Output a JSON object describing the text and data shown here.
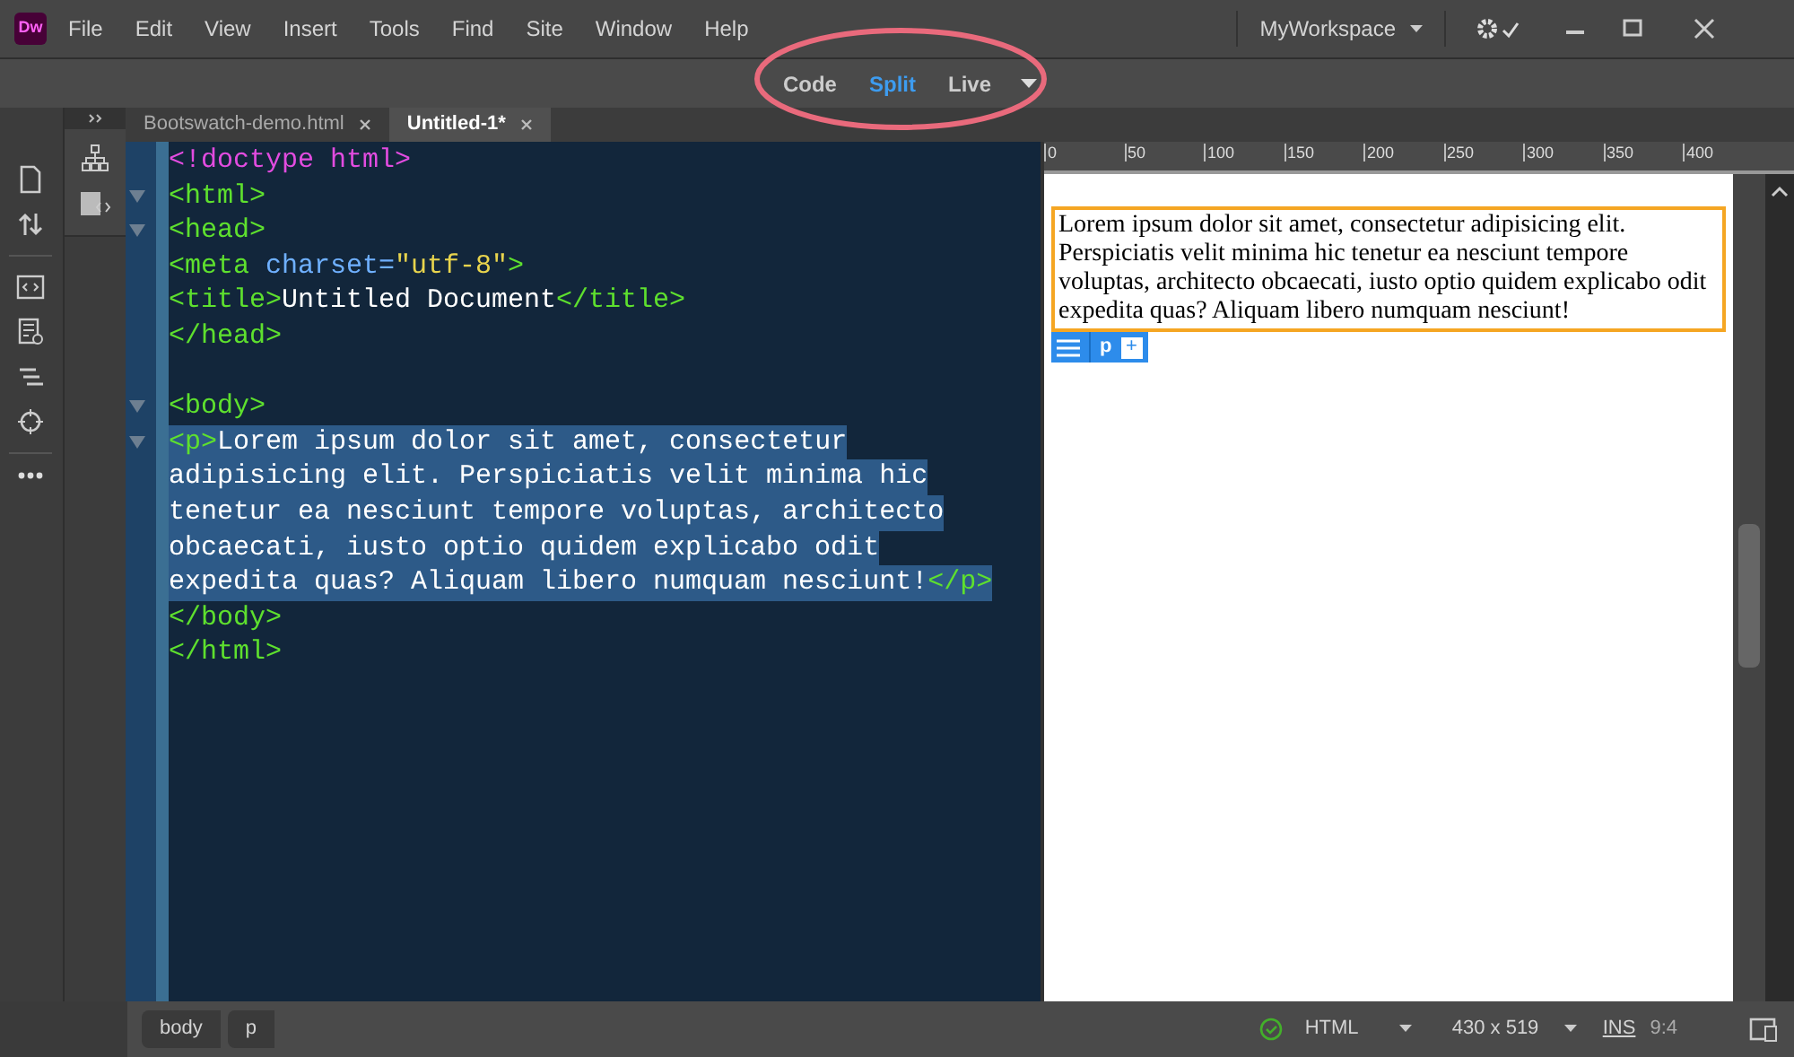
{
  "app": {
    "logo": "Dw"
  },
  "menu": [
    "File",
    "Edit",
    "View",
    "Insert",
    "Tools",
    "Find",
    "Site",
    "Window",
    "Help"
  ],
  "workspace": {
    "label": "MyWorkspace"
  },
  "view_modes": [
    {
      "label": "Code",
      "selected": false
    },
    {
      "label": "Split",
      "selected": true
    },
    {
      "label": "Live",
      "selected": false
    }
  ],
  "tabs": [
    {
      "label": "Bootswatch-demo.html",
      "selected": false
    },
    {
      "label": "Untitled-1*",
      "selected": true
    }
  ],
  "code_lines": [
    {
      "fold": false,
      "selected": false,
      "tokens": [
        {
          "kind": "doctype",
          "text": "<!doctype html>"
        }
      ]
    },
    {
      "fold": true,
      "selected": false,
      "tokens": [
        {
          "kind": "tag",
          "text": "<html>"
        }
      ]
    },
    {
      "fold": true,
      "selected": false,
      "tokens": [
        {
          "kind": "tag",
          "text": "<head>"
        }
      ]
    },
    {
      "fold": false,
      "selected": false,
      "tokens": [
        {
          "kind": "tag",
          "text": "<meta "
        },
        {
          "kind": "attr",
          "text": "charset="
        },
        {
          "kind": "string",
          "text": "\"utf-8\""
        },
        {
          "kind": "tag",
          "text": ">"
        }
      ]
    },
    {
      "fold": false,
      "selected": false,
      "tokens": [
        {
          "kind": "tag",
          "text": "<title>"
        },
        {
          "kind": "text",
          "text": "Untitled Document"
        },
        {
          "kind": "tag",
          "text": "</title>"
        }
      ]
    },
    {
      "fold": false,
      "selected": false,
      "tokens": [
        {
          "kind": "tag",
          "text": "</head>"
        }
      ]
    },
    {
      "fold": false,
      "selected": false
    },
    {
      "fold": true,
      "selected": false,
      "tokens": [
        {
          "kind": "tag",
          "text": "<body>"
        }
      ]
    },
    {
      "fold": true,
      "selected": true,
      "tokens": [
        {
          "kind": "tag",
          "text": "<p>"
        },
        {
          "kind": "text",
          "text": "Lorem ipsum dolor sit amet, consectetur"
        }
      ]
    },
    {
      "fold": false,
      "selected": true,
      "tokens": [
        {
          "kind": "text",
          "text": "adipisicing elit. Perspiciatis velit minima hic"
        }
      ]
    },
    {
      "fold": false,
      "selected": true,
      "tokens": [
        {
          "kind": "text",
          "text": "tenetur ea nesciunt tempore voluptas, architecto"
        }
      ]
    },
    {
      "fold": false,
      "selected": true,
      "tokens": [
        {
          "kind": "text",
          "text": "obcaecati, iusto optio quidem explicabo odit"
        }
      ]
    },
    {
      "fold": false,
      "selected": true,
      "tokens": [
        {
          "kind": "text",
          "text": "expedita quas? Aliquam libero numquam nesciunt!"
        },
        {
          "kind": "tag",
          "text": "</p>"
        }
      ]
    },
    {
      "fold": false,
      "selected": false,
      "tokens": [
        {
          "kind": "tag",
          "text": "</body>"
        }
      ]
    },
    {
      "fold": false,
      "selected": false,
      "tokens": [
        {
          "kind": "tag",
          "text": "</html>"
        }
      ]
    }
  ],
  "ruler": [
    "0",
    "50",
    "100",
    "150",
    "200",
    "250",
    "300",
    "350",
    "400"
  ],
  "preview": {
    "paragraph": "Lorem ipsum dolor sit amet, consectetur adipisicing elit. Perspiciatis velit minima hic tenetur ea nesciunt tempore voluptas, architecto obcaecati, iusto optio quidem explicabo odit expedita quas? Aliquam libero numquam nesciunt!",
    "tag_label": "p",
    "add": "+"
  },
  "status_bar": {
    "breadcrumbs": [
      "body",
      "p"
    ],
    "doc_type": "HTML",
    "size": "430 x 519",
    "mode": "INS",
    "position": "9:4"
  }
}
